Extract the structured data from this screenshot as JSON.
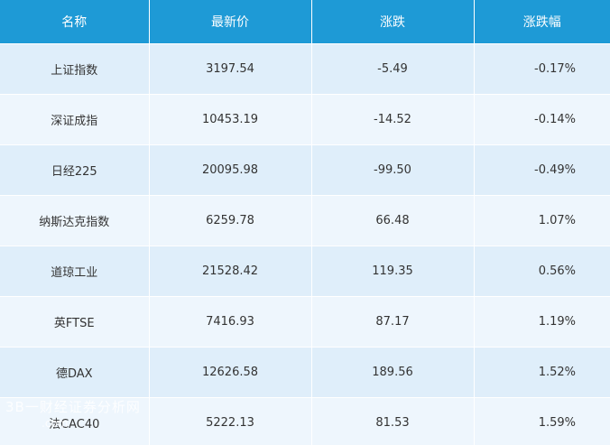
{
  "table": {
    "headers": [
      "名称",
      "最新价",
      "涨跌",
      "涨跌幅"
    ],
    "rows": [
      {
        "name": "上证指数",
        "price": "3197.54",
        "change": "-5.49",
        "pct": "-0.17%"
      },
      {
        "name": "深证成指",
        "price": "10453.19",
        "change": "-14.52",
        "pct": "-0.14%"
      },
      {
        "name": "日经225",
        "price": "20095.98",
        "change": "-99.50",
        "pct": "-0.49%"
      },
      {
        "name": "纳斯达克指数",
        "price": "6259.78",
        "change": "66.48",
        "pct": "1.07%"
      },
      {
        "name": "道琼工业",
        "price": "21528.42",
        "change": "119.35",
        "pct": "0.56%"
      },
      {
        "name": "英FTSE",
        "price": "7416.93",
        "change": "87.17",
        "pct": "1.19%"
      },
      {
        "name": "德DAX",
        "price": "12626.58",
        "change": "189.56",
        "pct": "1.52%"
      },
      {
        "name": "法CAC40",
        "price": "5222.13",
        "change": "81.53",
        "pct": "1.59%"
      }
    ]
  },
  "watermark": {
    "text": "3B一财经证券分析网",
    "sub": ".com"
  },
  "colors": {
    "header_bg": "#1e9ad6",
    "row_odd_bg": "#dfeefa",
    "row_even_bg": "#eef6fd"
  }
}
